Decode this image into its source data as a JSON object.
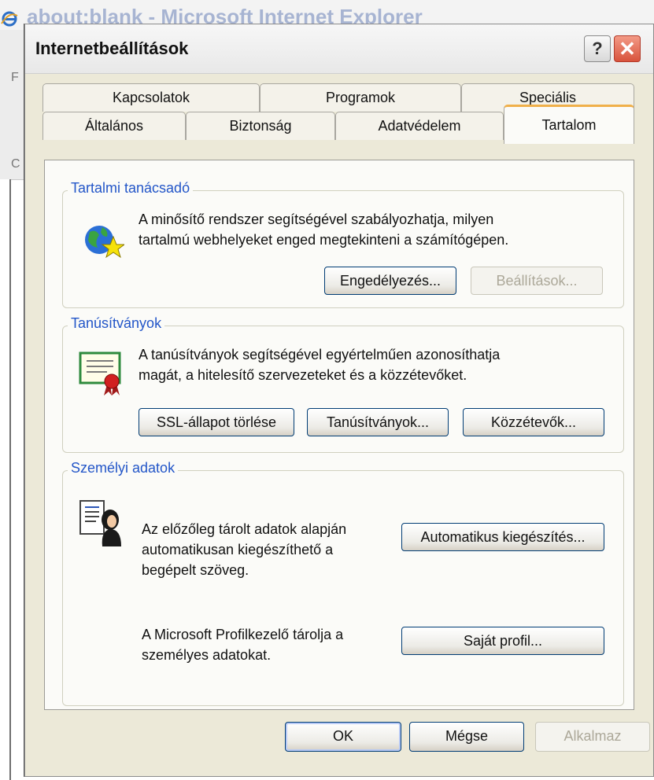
{
  "background_window": {
    "title": "about:blank - Microsoft Internet Explorer",
    "toolbar_letters": [
      "F",
      "C"
    ]
  },
  "dialog": {
    "title": "Internetbeállítások",
    "help_label": "?",
    "close_label": "X"
  },
  "tabs": {
    "row1": [
      "Kapcsolatok",
      "Programok",
      "Speciális"
    ],
    "row2": [
      "Általános",
      "Biztonság",
      "Adatvédelem",
      "Tartalom"
    ],
    "active": "Tartalom"
  },
  "content_advisor": {
    "label": "Tartalmi tanácsadó",
    "text_line1": "A minősítő rendszer segítségével szabályozhatja, milyen",
    "text_line2": "tartalmú webhelyeket enged megtekinteni a számítógépen.",
    "enable_button": "Engedélyezés...",
    "settings_button": "Beállítások..."
  },
  "certificates": {
    "label": "Tanúsítványok",
    "text_line1": "A tanúsítványok segítségével egyértelműen azonosíthatja",
    "text_line2": "magát, a hitelesítő szervezeteket és a közzétevőket.",
    "clear_ssl_button": "SSL-állapot törlése",
    "certificates_button": "Tanúsítványok...",
    "publishers_button": "Közzétevők..."
  },
  "personal_info": {
    "label": "Személyi adatok",
    "autocomplete_text_line1": "Az előzőleg tárolt adatok alapján",
    "autocomplete_text_line2": "automatikusan kiegészíthető a",
    "autocomplete_text_line3": "begépelt szöveg.",
    "autocomplete_button": "Automatikus kiegészítés...",
    "profile_text_line1": "A Microsoft Profilkezelő tárolja a",
    "profile_text_line2": "személyes adatokat.",
    "profile_button": "Saját profil..."
  },
  "footer": {
    "ok": "OK",
    "cancel": "Mégse",
    "apply": "Alkalmaz"
  },
  "colors": {
    "dialog_bg": "#ece9d8",
    "group_label": "#2356c8",
    "active_tab_accent": "#f0b04a",
    "close_button": "#d8533d"
  }
}
